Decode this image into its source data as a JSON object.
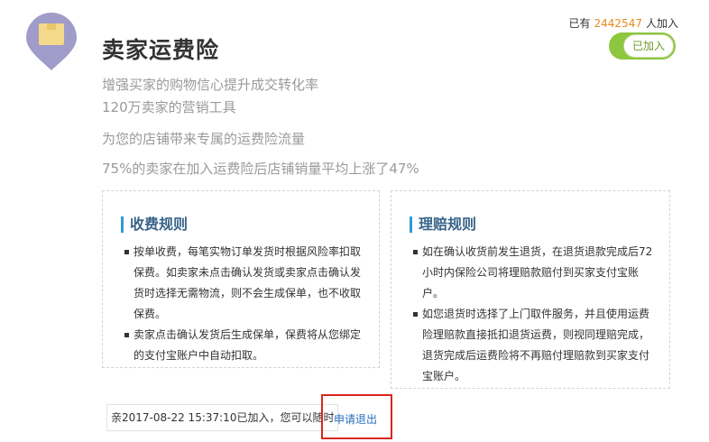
{
  "header": {
    "title": "卖家运费险",
    "joined_prefix": "已有",
    "joined_count": "2442547",
    "joined_suffix": "人加入",
    "toggle_label": "已加入"
  },
  "taglines": [
    "增强买家的购物信心提升成交转化率",
    "120万卖家的营销工具",
    "为您的店铺带来专属的运费险流量",
    "75%的卖家在加入运费险后店铺销量平均上涨了47%"
  ],
  "fee_rules": {
    "title": "收费规则",
    "items": [
      "按单收费，每笔实物订单发货时根据风险率扣取保费。如卖家未点击确认发货或卖家点击确认发货时选择无需物流，则不会生成保单，也不收取保费。",
      "卖家点击确认发货后生成保单，保费将从您绑定的支付宝账户中自动扣取。"
    ]
  },
  "claim_rules": {
    "title": "理赔规则",
    "items": [
      "如在确认收货前发生退货，在退货退款完成后72小时内保险公司将理赔款赔付到买家支付宝账户。",
      "如您退货时选择了上门取件服务，并且使用运费险理赔款直接抵扣退货运费，则视同理赔完成，退货完成后运费险将不再赔付理赔款到买家支付宝账户。"
    ]
  },
  "footer": {
    "note": "亲2017-08-22 15:37:10已加入，您可以随时",
    "quit_link": "申请退出"
  },
  "colors": {
    "accent_green": "#8dc63f",
    "count_orange": "#e68a1c",
    "link_blue": "#2a6ebd",
    "highlight_red": "#d9261c"
  },
  "icons": [
    "package-pin-icon"
  ]
}
